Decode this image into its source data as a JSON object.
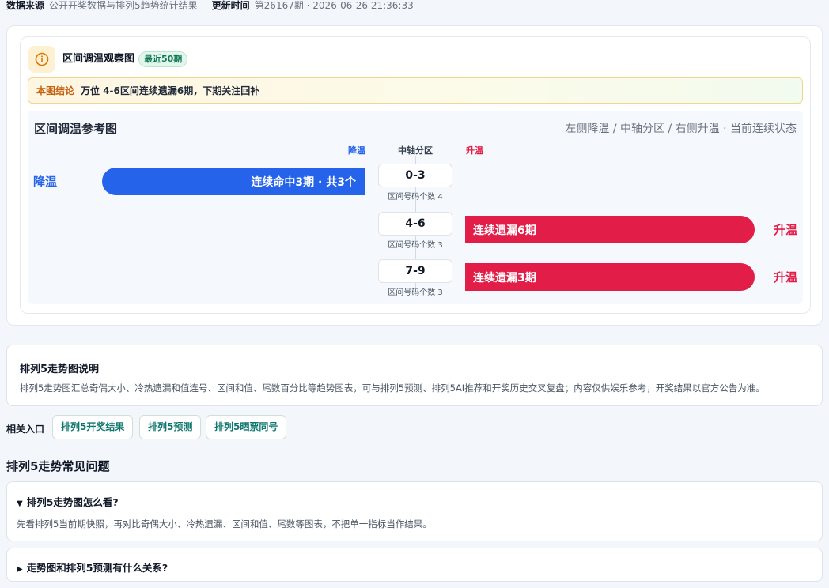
{
  "topbar": {
    "source_label": "数据来源",
    "source_value": "公开开奖数据与排列5趋势统计结果",
    "update_label": "更新时间",
    "update_value": "第26167期 · 2026-06-26 21:36:33"
  },
  "card": {
    "icon": "info-circle-icon",
    "title": "区间调温观察图",
    "badge": "最近50期",
    "conclusion_tag": "本图结论",
    "conclusion_text": "万位 4-6区间连续遗漏6期，下期关注回补"
  },
  "chart": {
    "title": "区间调温参考图",
    "subtitle": "左侧降温 / 中轴分区 / 右侧升温 · 当前连续状态",
    "header_left": "降温",
    "header_center": "中轴分区",
    "header_right": "升温",
    "colors": {
      "cool": "#2563eb",
      "warm": "#e11d48"
    }
  },
  "chart_data": {
    "type": "bar",
    "categories": [
      "0-3",
      "4-6",
      "7-9"
    ],
    "rows": [
      {
        "zone": "0-3",
        "count_label": "区间号码个数 4",
        "direction": "cool",
        "side_label": "降温",
        "bar_label": "连续命中3期 · 共3个",
        "streak": 3
      },
      {
        "zone": "4-6",
        "count_label": "区间号码个数 3",
        "direction": "warm",
        "side_label": "升温",
        "bar_label": "连续遗漏6期",
        "streak": 6
      },
      {
        "zone": "7-9",
        "count_label": "区间号码个数 3",
        "direction": "warm",
        "side_label": "升温",
        "bar_label": "连续遗漏3期",
        "streak": 3
      }
    ]
  },
  "description": {
    "title": "排列5走势图说明",
    "text": "排列5走势图汇总奇偶大小、冷热遗漏和值连号、区间和值、尾数百分比等趋势图表，可与排列5预测、排列5AI推荐和开奖历史交叉复盘；内容仅供娱乐参考，开奖结果以官方公告为准。"
  },
  "related": {
    "label": "相关入口",
    "links": [
      "排列5开奖结果",
      "排列5预测",
      "排列5晒票同号"
    ]
  },
  "faq": {
    "heading": "排列5走势常见问题",
    "items": [
      {
        "caret": "▼",
        "question": "排列5走势图怎么看?",
        "answer": "先看排列5当前期快照，再对比奇偶大小、冷热遗漏、区间和值、尾数等图表，不把单一指标当作结果。"
      },
      {
        "caret": "▶",
        "question": "走势图和排列5预测有什么关系?"
      }
    ]
  }
}
